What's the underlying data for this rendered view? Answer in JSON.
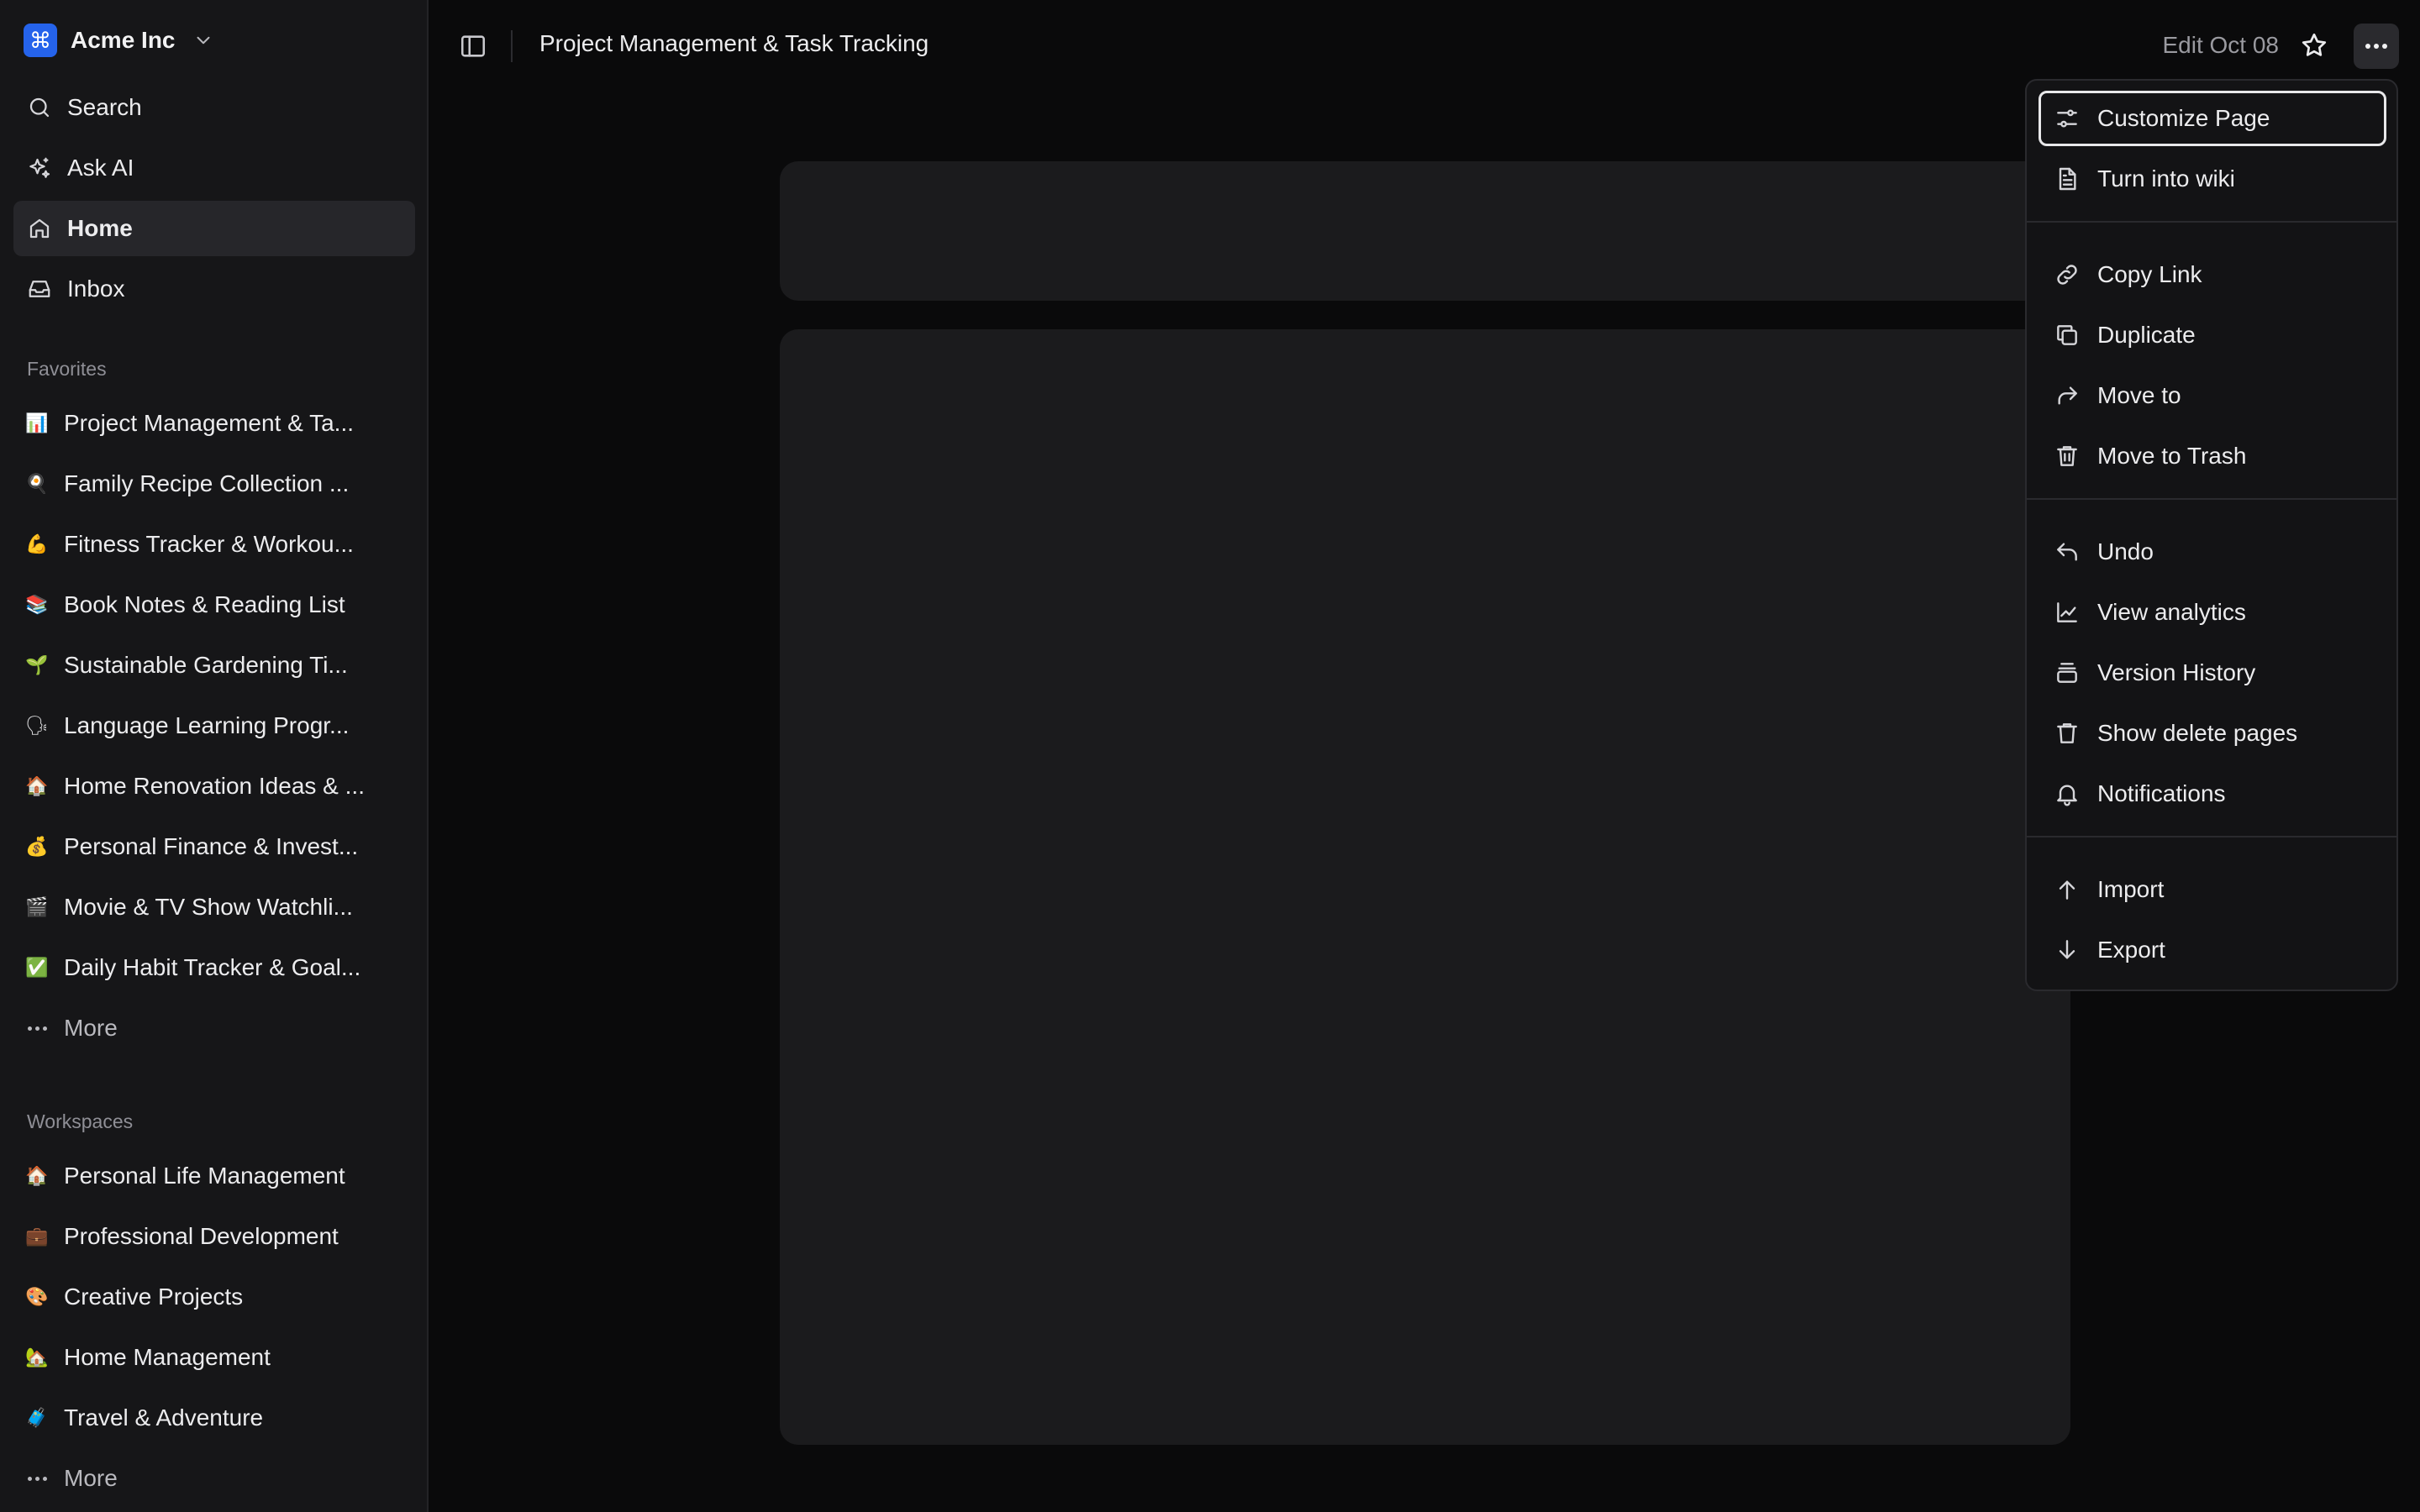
{
  "workspace": {
    "name": "Acme Inc",
    "logo_glyph": "⌘",
    "logo_color": "#2563eb"
  },
  "nav": [
    {
      "label": "Search",
      "icon": "search-icon"
    },
    {
      "label": "Ask AI",
      "icon": "sparkles-icon"
    },
    {
      "label": "Home",
      "icon": "home-icon",
      "active": true
    },
    {
      "label": "Inbox",
      "icon": "inbox-icon"
    }
  ],
  "favorites": {
    "label": "Favorites",
    "items": [
      {
        "emoji": "📊",
        "label": "Project Management & Ta..."
      },
      {
        "emoji": "🍳",
        "label": "Family Recipe Collection ..."
      },
      {
        "emoji": "💪",
        "label": "Fitness Tracker & Workou..."
      },
      {
        "emoji": "📚",
        "label": "Book Notes & Reading List"
      },
      {
        "emoji": "🌱",
        "label": "Sustainable Gardening Ti..."
      },
      {
        "emoji": "🗣",
        "label": "Language Learning Progr..."
      },
      {
        "emoji": "🏠",
        "label": "Home Renovation Ideas & ..."
      },
      {
        "emoji": "💰",
        "label": "Personal Finance & Invest..."
      },
      {
        "emoji": "🎬",
        "label": "Movie & TV Show Watchli..."
      },
      {
        "emoji": "✅",
        "label": "Daily Habit Tracker & Goal..."
      }
    ],
    "more_label": "More"
  },
  "workspaces": {
    "label": "Workspaces",
    "items": [
      {
        "emoji": "🏠",
        "label": "Personal Life Management"
      },
      {
        "emoji": "💼",
        "label": "Professional Development"
      },
      {
        "emoji": "🎨",
        "label": "Creative Projects"
      },
      {
        "emoji": "🏡",
        "label": "Home Management"
      },
      {
        "emoji": "🧳",
        "label": "Travel & Adventure"
      }
    ],
    "more_label": "More"
  },
  "header": {
    "title": "Project Management & Task Tracking",
    "edit_date": "Edit Oct 08"
  },
  "menu": {
    "groups": [
      [
        {
          "label": "Customize Page",
          "icon": "sliders-icon",
          "focused": true
        },
        {
          "label": "Turn into wiki",
          "icon": "file-text-icon"
        }
      ],
      [
        {
          "label": "Copy Link",
          "icon": "link-icon"
        },
        {
          "label": "Duplicate",
          "icon": "copy-icon"
        },
        {
          "label": "Move to",
          "icon": "corner-up-right-icon"
        },
        {
          "label": "Move to Trash",
          "icon": "trash-icon"
        }
      ],
      [
        {
          "label": "Undo",
          "icon": "undo-icon"
        },
        {
          "label": "View analytics",
          "icon": "line-chart-icon"
        },
        {
          "label": "Version History",
          "icon": "layers-icon"
        },
        {
          "label": "Show delete pages",
          "icon": "trash-outline-icon"
        },
        {
          "label": "Notifications",
          "icon": "bell-icon"
        }
      ],
      [
        {
          "label": "Import",
          "icon": "arrow-up-icon"
        },
        {
          "label": "Export",
          "icon": "arrow-down-icon"
        }
      ]
    ]
  }
}
